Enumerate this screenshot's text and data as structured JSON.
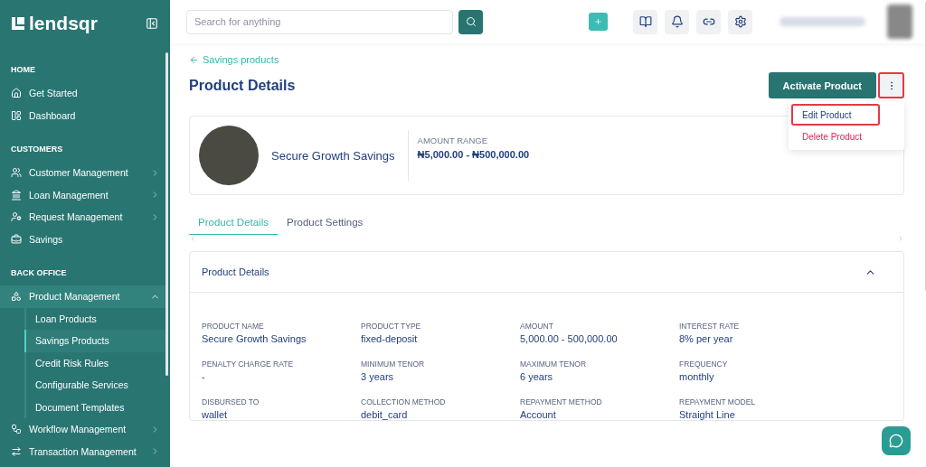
{
  "sidebar": {
    "logo": "lendsqr",
    "sections": [
      {
        "title": "HOME",
        "items": [
          {
            "label": "Get Started",
            "expandable": false,
            "selected": false
          },
          {
            "label": "Dashboard",
            "expandable": false,
            "selected": false
          }
        ]
      },
      {
        "title": "CUSTOMERS",
        "items": [
          {
            "label": "Customer Management",
            "expandable": true,
            "expanded": false,
            "selected": false
          },
          {
            "label": "Loan Management",
            "expandable": true,
            "expanded": false,
            "selected": false
          },
          {
            "label": "Request Management",
            "expandable": true,
            "expanded": false,
            "selected": false
          },
          {
            "label": "Savings",
            "expandable": false,
            "selected": false
          }
        ]
      },
      {
        "title": "BACK OFFICE",
        "items": [
          {
            "label": "Product Management",
            "expandable": true,
            "expanded": true,
            "selected": true,
            "children": [
              {
                "label": "Loan Products",
                "selected": false
              },
              {
                "label": "Savings Products",
                "selected": true
              },
              {
                "label": "Credit Risk Rules",
                "selected": false
              },
              {
                "label": "Configurable Services",
                "selected": false
              },
              {
                "label": "Document Templates",
                "selected": false
              }
            ]
          },
          {
            "label": "Workflow Management",
            "expandable": true,
            "expanded": false,
            "selected": false
          },
          {
            "label": "Transaction Management",
            "expandable": true,
            "expanded": false,
            "selected": false
          }
        ]
      }
    ]
  },
  "header": {
    "search": {
      "placeholder": "Search for anything"
    }
  },
  "breadcrumb": "Savings products",
  "title": "Product Details",
  "actions": {
    "primary": "Activate Product",
    "more_highlighted": true,
    "menu": [
      {
        "label": "Edit Product",
        "kind": "normal",
        "highlighted": true
      },
      {
        "label": "Delete Product",
        "kind": "danger",
        "highlighted": false
      }
    ]
  },
  "product": {
    "name": "Secure Growth Savings",
    "range_label": "AMOUNT RANGE",
    "range_value": "₦5,000.00 - ₦500,000.00"
  },
  "tabs": [
    {
      "label": "Product Details",
      "selected": true
    },
    {
      "label": "Product Settings",
      "selected": false
    }
  ],
  "panel": {
    "title": "Product Details",
    "expanded": true,
    "fields": [
      {
        "label": "PRODUCT NAME",
        "value": "Secure Growth Savings"
      },
      {
        "label": "PRODUCT TYPE",
        "value": "fixed-deposit"
      },
      {
        "label": "AMOUNT",
        "value": "5,000.00 - 500,000.00"
      },
      {
        "label": "INTEREST RATE",
        "value": "8% per year"
      },
      {
        "label": "PENALTY CHARGE RATE",
        "value": "-"
      },
      {
        "label": "MINIMUM TENOR",
        "value": "3 years"
      },
      {
        "label": "MAXIMUM TENOR",
        "value": "6 years"
      },
      {
        "label": "FREQUENCY",
        "value": "monthly"
      },
      {
        "label": "DISBURSED TO",
        "value": "wallet"
      },
      {
        "label": "COLLECTION METHOD",
        "value": "debit_card"
      },
      {
        "label": "REPAYMENT METHOD",
        "value": "Account"
      },
      {
        "label": "REPAYMENT MODEL",
        "value": "Straight Line"
      }
    ]
  }
}
